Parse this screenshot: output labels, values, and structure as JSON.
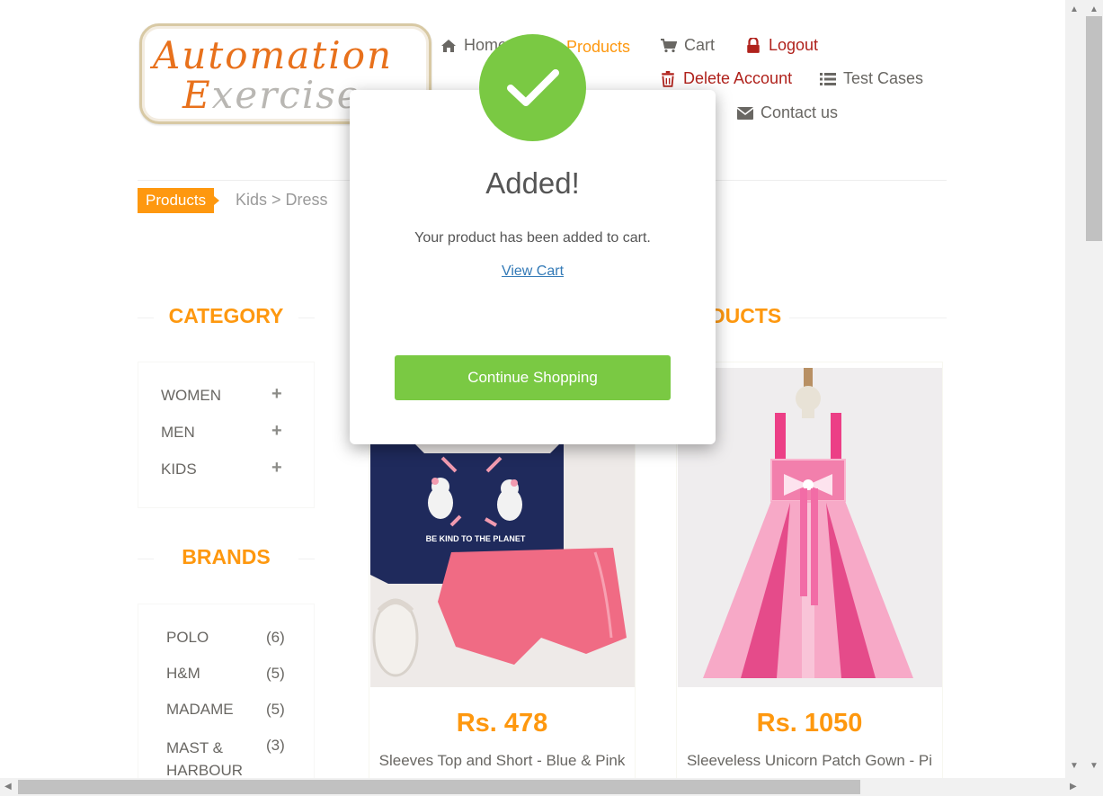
{
  "logo": {
    "line1": "Automation",
    "line2": "Exercise"
  },
  "nav": {
    "home": "Home",
    "products": "Products",
    "cart": "Cart",
    "logout": "Logout",
    "delete_account": "Delete Account",
    "test_cases": "Test Cases",
    "contact_us": "Contact us"
  },
  "breadcrumb": {
    "active": "Products",
    "rest": "Kids > Dress"
  },
  "sidebar": {
    "category_title": "CATEGORY",
    "categories": [
      "WOMEN",
      "MEN",
      "KIDS"
    ],
    "brands_title": "BRANDS",
    "brands": [
      {
        "name": "POLO",
        "count": "(6)"
      },
      {
        "name": "H&M",
        "count": "(5)"
      },
      {
        "name": "MADAME",
        "count": "(5)"
      },
      {
        "name": "MAST & HARBOUR",
        "count": "(3)"
      }
    ]
  },
  "products_title_fragment": "DUCTS",
  "products": [
    {
      "price": "Rs. 478",
      "name": "Sleeves Top and Short - Blue & Pink",
      "print": "BE KIND TO THE PLANET"
    },
    {
      "price": "Rs. 1050",
      "name": "Sleeveless Unicorn Patch Gown - Pi"
    }
  ],
  "modal": {
    "title": "Added!",
    "message": "Your product has been added to cart.",
    "link": "View Cart",
    "button": "Continue Shopping"
  },
  "colors": {
    "accent": "#fe980f",
    "success": "#7ac943",
    "danger": "#b0221c"
  }
}
